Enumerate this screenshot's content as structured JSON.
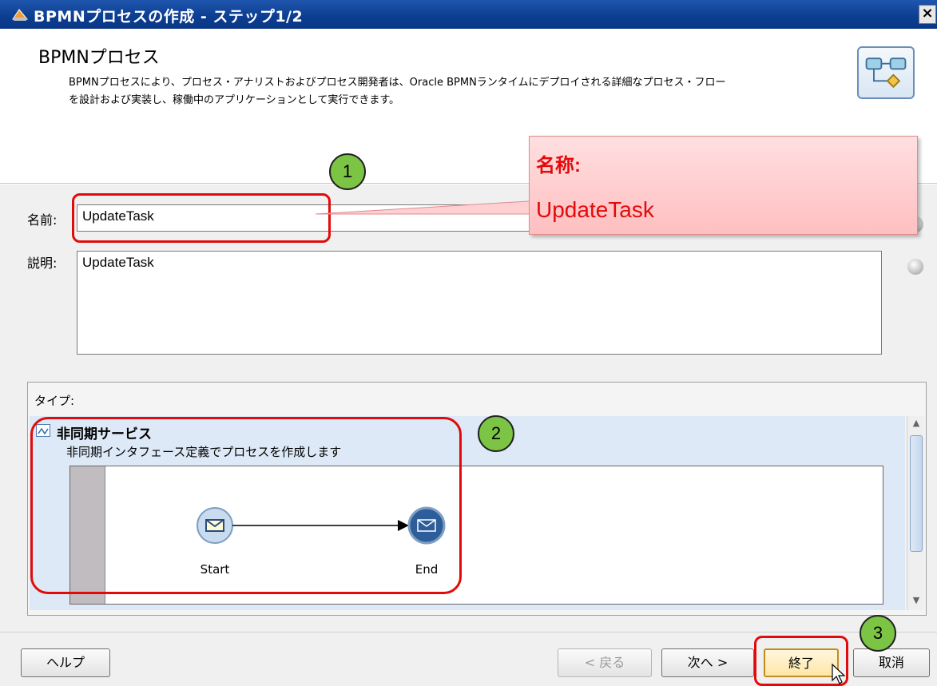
{
  "window": {
    "title": "BPMNプロセスの作成 - ステップ1/2",
    "close_glyph": "×"
  },
  "header": {
    "title": "BPMNプロセス",
    "description_line1": "BPMNプロセスにより、プロセス・アナリストおよびプロセス開発者は、Oracle BPMNランタイムにデプロイされる詳細なプロセス・フロー",
    "description_line2": "を設計および実装し、稼働中のアプリケーションとして実行できます。",
    "icon": "process-diagram-icon"
  },
  "form": {
    "name_label": "名前:",
    "name_value": "UpdateTask",
    "description_label": "説明:",
    "description_value": "UpdateTask"
  },
  "type_section": {
    "label": "タイプ:",
    "selected_option": {
      "title": "非同期サービス",
      "description": "非同期インタフェース定義でプロセスを作成します",
      "icon": "async-service-icon",
      "diagram": {
        "start_label": "Start",
        "end_label": "End"
      }
    },
    "scroll_position": 0.05
  },
  "buttons": {
    "help": "ヘルプ",
    "back": "< 戻る",
    "next": "次へ >",
    "finish": "終了",
    "cancel": "取消"
  },
  "annotations": {
    "step1": "1",
    "step2": "2",
    "step3": "3",
    "callout_title": "名称:",
    "callout_value": "UpdateTask",
    "accent_color": "#e20b0b",
    "marker_color": "#7cc443"
  }
}
